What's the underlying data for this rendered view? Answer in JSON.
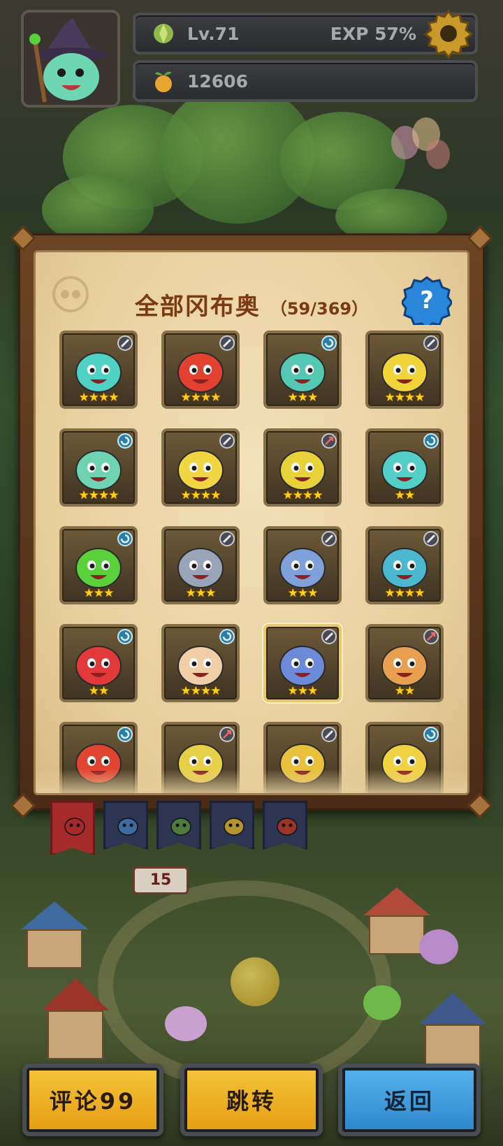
{
  "hud": {
    "level": "Lv.71",
    "exp": "EXP 57%",
    "coins": "12606",
    "icons": {
      "level": "leaf-gem-icon",
      "coins": "fruit-coin-icon",
      "settings": "gear-icon"
    }
  },
  "panel": {
    "title": "全部冈布奥",
    "count": "（59/369）",
    "help_icon": "question-icon"
  },
  "cards": [
    {
      "stars": "★★★★",
      "badge": "sword",
      "color": "#4fd1c4"
    },
    {
      "stars": "★★★★",
      "badge": "sword",
      "color": "#e24130"
    },
    {
      "stars": "★★★",
      "badge": "swirl",
      "color": "#55c8b3"
    },
    {
      "stars": "★★★★",
      "badge": "sword",
      "color": "#f0d43a"
    },
    {
      "stars": "★★★★",
      "badge": "swirl",
      "color": "#6fd2b0"
    },
    {
      "stars": "★★★★",
      "badge": "sword",
      "color": "#f2d542"
    },
    {
      "stars": "★★★★",
      "badge": "arrow",
      "color": "#e8d23a"
    },
    {
      "stars": "★★",
      "badge": "swirl",
      "color": "#54cfc8"
    },
    {
      "stars": "★★★",
      "badge": "swirl",
      "color": "#5ad13a"
    },
    {
      "stars": "★★★",
      "badge": "sword",
      "color": "#9aa4b8"
    },
    {
      "stars": "★★★",
      "badge": "sword",
      "color": "#7fa0d8"
    },
    {
      "stars": "★★★★",
      "badge": "sword",
      "color": "#4cb8d0"
    },
    {
      "stars": "★★",
      "badge": "swirl",
      "color": "#e23a3a"
    },
    {
      "stars": "★★★★",
      "badge": "swirl",
      "color": "#f0cfa8"
    },
    {
      "stars": "★★★",
      "badge": "sword",
      "color": "#6c8ad8",
      "selected": true
    },
    {
      "stars": "★★",
      "badge": "arrow",
      "color": "#e8a050"
    },
    {
      "stars": "",
      "badge": "swirl",
      "color": "#e04532"
    },
    {
      "stars": "",
      "badge": "arrow",
      "color": "#e8cf48"
    },
    {
      "stars": "",
      "badge": "sword",
      "color": "#e8c03c"
    },
    {
      "stars": "",
      "badge": "swirl",
      "color": "#f0d242"
    }
  ],
  "tabs": [
    {
      "name": "all",
      "active": true,
      "color": "#a62a2a"
    },
    {
      "name": "blue",
      "active": false,
      "color": "#3f6aa0"
    },
    {
      "name": "green",
      "active": false,
      "color": "#4f7a3e"
    },
    {
      "name": "yellow",
      "active": false,
      "color": "#b4942c"
    },
    {
      "name": "red",
      "active": false,
      "color": "#9a3428"
    }
  ],
  "buttons": {
    "comment": "评论99",
    "jump": "跳转",
    "back": "返回"
  },
  "scenery": {
    "signpost": "15"
  }
}
